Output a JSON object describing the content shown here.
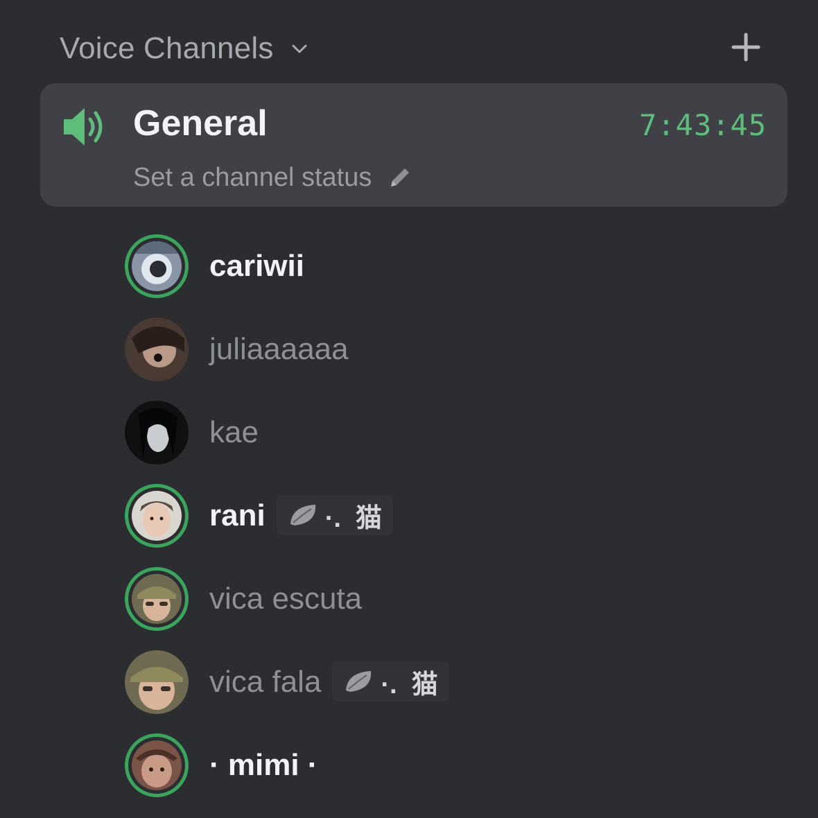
{
  "category": {
    "label": "Voice Channels",
    "collapse_icon": "chevron-down-icon",
    "add_icon": "plus-icon"
  },
  "channel": {
    "name": "General",
    "icon": "speaker-icon",
    "elapsed": "7:43:45",
    "status_placeholder": "Set a channel status",
    "status_icon": "pencil-icon",
    "accent_color": "#5fbd7c"
  },
  "members": [
    {
      "name": "cariwii",
      "speaking": true,
      "highlighted": true,
      "tag": null
    },
    {
      "name": "juliaaaaaa",
      "speaking": false,
      "highlighted": false,
      "tag": null
    },
    {
      "name": "kae",
      "speaking": false,
      "highlighted": false,
      "tag": null
    },
    {
      "name": "rani",
      "speaking": true,
      "highlighted": true,
      "tag": {
        "icon": "leaf-icon",
        "text": "·.  猫"
      }
    },
    {
      "name": "vica escuta",
      "speaking": true,
      "highlighted": false,
      "tag": null
    },
    {
      "name": "vica fala",
      "speaking": false,
      "highlighted": false,
      "tag": {
        "icon": "leaf-icon",
        "text": "·.  猫"
      }
    },
    {
      "name": "· mimi ·",
      "speaking": true,
      "highlighted": true,
      "tag": null
    }
  ]
}
